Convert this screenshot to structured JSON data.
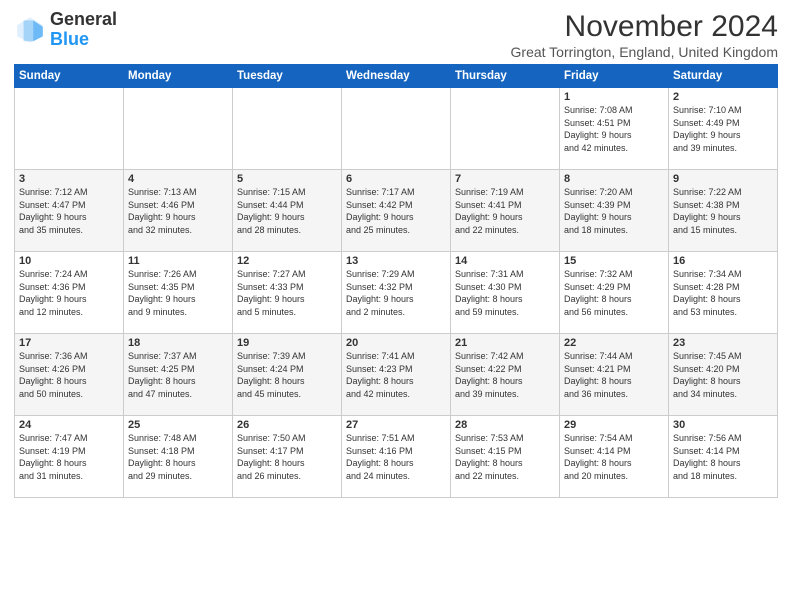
{
  "header": {
    "logo_general": "General",
    "logo_blue": "Blue",
    "month_title": "November 2024",
    "location": "Great Torrington, England, United Kingdom"
  },
  "weekdays": [
    "Sunday",
    "Monday",
    "Tuesday",
    "Wednesday",
    "Thursday",
    "Friday",
    "Saturday"
  ],
  "weeks": [
    [
      {
        "day": "",
        "info": ""
      },
      {
        "day": "",
        "info": ""
      },
      {
        "day": "",
        "info": ""
      },
      {
        "day": "",
        "info": ""
      },
      {
        "day": "",
        "info": ""
      },
      {
        "day": "1",
        "info": "Sunrise: 7:08 AM\nSunset: 4:51 PM\nDaylight: 9 hours\nand 42 minutes."
      },
      {
        "day": "2",
        "info": "Sunrise: 7:10 AM\nSunset: 4:49 PM\nDaylight: 9 hours\nand 39 minutes."
      }
    ],
    [
      {
        "day": "3",
        "info": "Sunrise: 7:12 AM\nSunset: 4:47 PM\nDaylight: 9 hours\nand 35 minutes."
      },
      {
        "day": "4",
        "info": "Sunrise: 7:13 AM\nSunset: 4:46 PM\nDaylight: 9 hours\nand 32 minutes."
      },
      {
        "day": "5",
        "info": "Sunrise: 7:15 AM\nSunset: 4:44 PM\nDaylight: 9 hours\nand 28 minutes."
      },
      {
        "day": "6",
        "info": "Sunrise: 7:17 AM\nSunset: 4:42 PM\nDaylight: 9 hours\nand 25 minutes."
      },
      {
        "day": "7",
        "info": "Sunrise: 7:19 AM\nSunset: 4:41 PM\nDaylight: 9 hours\nand 22 minutes."
      },
      {
        "day": "8",
        "info": "Sunrise: 7:20 AM\nSunset: 4:39 PM\nDaylight: 9 hours\nand 18 minutes."
      },
      {
        "day": "9",
        "info": "Sunrise: 7:22 AM\nSunset: 4:38 PM\nDaylight: 9 hours\nand 15 minutes."
      }
    ],
    [
      {
        "day": "10",
        "info": "Sunrise: 7:24 AM\nSunset: 4:36 PM\nDaylight: 9 hours\nand 12 minutes."
      },
      {
        "day": "11",
        "info": "Sunrise: 7:26 AM\nSunset: 4:35 PM\nDaylight: 9 hours\nand 9 minutes."
      },
      {
        "day": "12",
        "info": "Sunrise: 7:27 AM\nSunset: 4:33 PM\nDaylight: 9 hours\nand 5 minutes."
      },
      {
        "day": "13",
        "info": "Sunrise: 7:29 AM\nSunset: 4:32 PM\nDaylight: 9 hours\nand 2 minutes."
      },
      {
        "day": "14",
        "info": "Sunrise: 7:31 AM\nSunset: 4:30 PM\nDaylight: 8 hours\nand 59 minutes."
      },
      {
        "day": "15",
        "info": "Sunrise: 7:32 AM\nSunset: 4:29 PM\nDaylight: 8 hours\nand 56 minutes."
      },
      {
        "day": "16",
        "info": "Sunrise: 7:34 AM\nSunset: 4:28 PM\nDaylight: 8 hours\nand 53 minutes."
      }
    ],
    [
      {
        "day": "17",
        "info": "Sunrise: 7:36 AM\nSunset: 4:26 PM\nDaylight: 8 hours\nand 50 minutes."
      },
      {
        "day": "18",
        "info": "Sunrise: 7:37 AM\nSunset: 4:25 PM\nDaylight: 8 hours\nand 47 minutes."
      },
      {
        "day": "19",
        "info": "Sunrise: 7:39 AM\nSunset: 4:24 PM\nDaylight: 8 hours\nand 45 minutes."
      },
      {
        "day": "20",
        "info": "Sunrise: 7:41 AM\nSunset: 4:23 PM\nDaylight: 8 hours\nand 42 minutes."
      },
      {
        "day": "21",
        "info": "Sunrise: 7:42 AM\nSunset: 4:22 PM\nDaylight: 8 hours\nand 39 minutes."
      },
      {
        "day": "22",
        "info": "Sunrise: 7:44 AM\nSunset: 4:21 PM\nDaylight: 8 hours\nand 36 minutes."
      },
      {
        "day": "23",
        "info": "Sunrise: 7:45 AM\nSunset: 4:20 PM\nDaylight: 8 hours\nand 34 minutes."
      }
    ],
    [
      {
        "day": "24",
        "info": "Sunrise: 7:47 AM\nSunset: 4:19 PM\nDaylight: 8 hours\nand 31 minutes."
      },
      {
        "day": "25",
        "info": "Sunrise: 7:48 AM\nSunset: 4:18 PM\nDaylight: 8 hours\nand 29 minutes."
      },
      {
        "day": "26",
        "info": "Sunrise: 7:50 AM\nSunset: 4:17 PM\nDaylight: 8 hours\nand 26 minutes."
      },
      {
        "day": "27",
        "info": "Sunrise: 7:51 AM\nSunset: 4:16 PM\nDaylight: 8 hours\nand 24 minutes."
      },
      {
        "day": "28",
        "info": "Sunrise: 7:53 AM\nSunset: 4:15 PM\nDaylight: 8 hours\nand 22 minutes."
      },
      {
        "day": "29",
        "info": "Sunrise: 7:54 AM\nSunset: 4:14 PM\nDaylight: 8 hours\nand 20 minutes."
      },
      {
        "day": "30",
        "info": "Sunrise: 7:56 AM\nSunset: 4:14 PM\nDaylight: 8 hours\nand 18 minutes."
      }
    ]
  ]
}
